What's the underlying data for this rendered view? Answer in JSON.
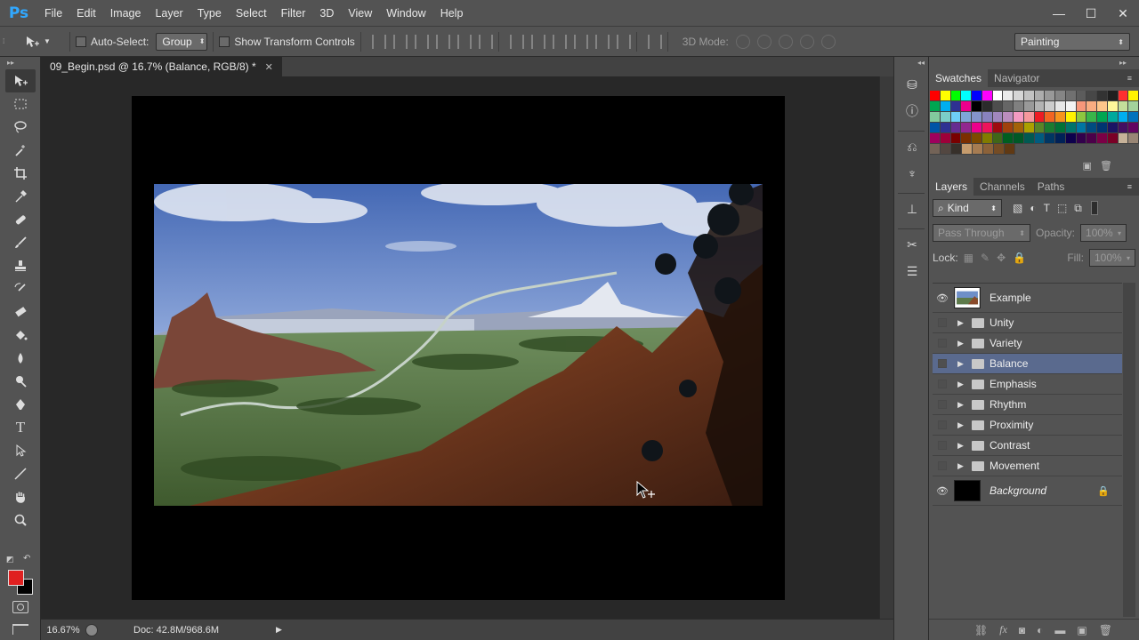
{
  "app": {
    "logo": "Ps"
  },
  "menu": [
    "File",
    "Edit",
    "Image",
    "Layer",
    "Type",
    "Select",
    "Filter",
    "3D",
    "View",
    "Window",
    "Help"
  ],
  "window_controls": {
    "minimize": "—",
    "maximize": "☐",
    "close": "✕"
  },
  "options": {
    "auto_select_label": "Auto-Select:",
    "auto_select_value": "Group",
    "show_transform_label": "Show Transform Controls",
    "mode3d_label": "3D Mode:",
    "workspace": "Painting"
  },
  "document": {
    "tab_title": "09_Begin.psd @ 16.7% (Balance, RGB/8) *",
    "close": "✕"
  },
  "status": {
    "zoom": "16.67%",
    "doc_info": "Doc: 42.8M/968.6M"
  },
  "panels": {
    "swatch_tabs": [
      "Swatches",
      "Navigator"
    ],
    "layer_tabs": [
      "Layers",
      "Channels",
      "Paths"
    ],
    "filter_kind": "Kind",
    "blend_mode": "Pass Through",
    "opacity_label": "Opacity:",
    "opacity_value": "100%",
    "lock_label": "Lock:",
    "fill_label": "Fill:",
    "fill_value": "100%"
  },
  "colors": {
    "foreground": "#e02020",
    "background": "#000000",
    "selected_layer": "#5a6a8e"
  },
  "layers": [
    {
      "name": "Example",
      "visible": true,
      "type": "image"
    },
    {
      "name": "Unity",
      "visible": false,
      "type": "group"
    },
    {
      "name": "Variety",
      "visible": false,
      "type": "group"
    },
    {
      "name": "Balance",
      "visible": false,
      "type": "group",
      "selected": true
    },
    {
      "name": "Emphasis",
      "visible": false,
      "type": "group"
    },
    {
      "name": "Rhythm",
      "visible": false,
      "type": "group"
    },
    {
      "name": "Proximity",
      "visible": false,
      "type": "group"
    },
    {
      "name": "Contrast",
      "visible": false,
      "type": "group"
    },
    {
      "name": "Movement",
      "visible": false,
      "type": "group"
    },
    {
      "name": "Background",
      "visible": true,
      "type": "background",
      "locked": true
    }
  ]
}
